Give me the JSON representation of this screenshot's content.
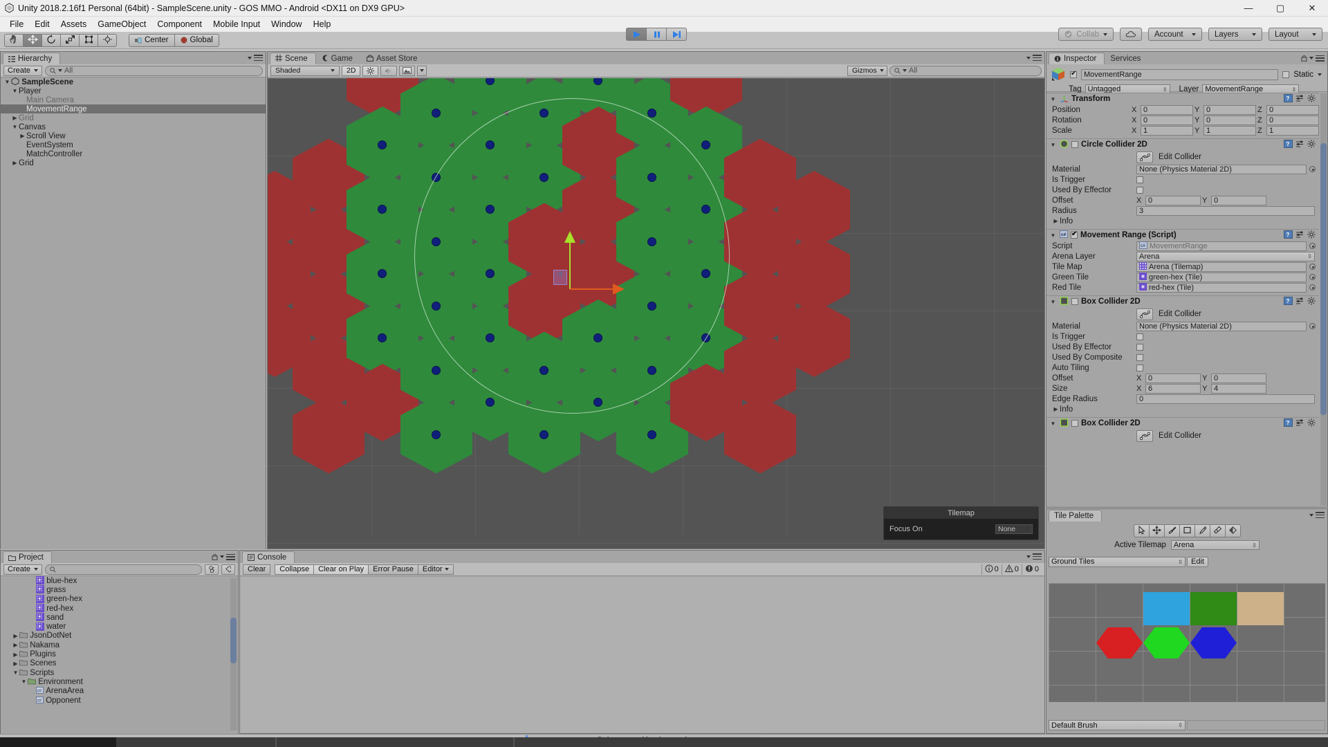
{
  "window": {
    "title": "Unity 2018.2.16f1 Personal (64bit) - SampleScene.unity - GOS MMO - Android <DX11 on DX9 GPU>",
    "minimize": "—",
    "maximize": "▢",
    "close": "✕",
    "app_icon": "unity-logo-icon"
  },
  "menubar": {
    "items": [
      "File",
      "Edit",
      "Assets",
      "GameObject",
      "Component",
      "Mobile Input",
      "Window",
      "Help"
    ]
  },
  "toolbar": {
    "tools": [
      {
        "name": "hand-tool",
        "glyph": "✋",
        "active": false
      },
      {
        "name": "move-tool",
        "glyph": "✥",
        "active": true
      },
      {
        "name": "rotate-tool",
        "glyph": "⟳",
        "active": false
      },
      {
        "name": "scale-tool",
        "glyph": "⤢",
        "active": false
      },
      {
        "name": "rect-tool",
        "glyph": "▣",
        "active": false
      },
      {
        "name": "transform-tool",
        "glyph": "✺",
        "active": false
      }
    ],
    "pivot_label": "Center",
    "space_label": "Global",
    "play_label": "▶",
    "pause_label": "❙❙",
    "step_label": "▶❙",
    "play_active": true,
    "collab_label": "Collab",
    "cloud_label": "cloud-icon",
    "account_label": "Account",
    "layers_label": "Layers",
    "layout_label": "Layout"
  },
  "hierarchy": {
    "tab": "Hierarchy",
    "create_label": "Create",
    "search_placeholder": "All",
    "items": [
      {
        "label": "SampleScene",
        "depth": 0,
        "arrow": "down",
        "icon": "scene-icon",
        "selected": false,
        "dim": false,
        "bold": true
      },
      {
        "label": "Player",
        "depth": 1,
        "arrow": "down",
        "icon": "",
        "selected": false,
        "dim": false
      },
      {
        "label": "Main Camera",
        "depth": 2,
        "arrow": "none",
        "icon": "",
        "selected": false,
        "dim": true
      },
      {
        "label": "MovementRange",
        "depth": 2,
        "arrow": "none",
        "icon": "",
        "selected": true,
        "dim": true
      },
      {
        "label": "Grid",
        "depth": 1,
        "arrow": "right",
        "icon": "",
        "selected": false,
        "dim": true
      },
      {
        "label": "Canvas",
        "depth": 1,
        "arrow": "down",
        "icon": "",
        "selected": false,
        "dim": false
      },
      {
        "label": "Scroll View",
        "depth": 2,
        "arrow": "right",
        "icon": "",
        "selected": false,
        "dim": false
      },
      {
        "label": "EventSystem",
        "depth": 2,
        "arrow": "none",
        "icon": "",
        "selected": false,
        "dim": false
      },
      {
        "label": "MatchController",
        "depth": 2,
        "arrow": "none",
        "icon": "",
        "selected": false,
        "dim": false
      },
      {
        "label": "Grid",
        "depth": 1,
        "arrow": "right",
        "icon": "",
        "selected": false,
        "dim": false
      }
    ]
  },
  "scene": {
    "tabs": [
      {
        "label": "Scene",
        "icon": "grid-icon",
        "active": true
      },
      {
        "label": "Game",
        "icon": "gamepad-icon",
        "active": false
      },
      {
        "label": "Asset Store",
        "icon": "store-icon",
        "active": false
      }
    ],
    "shading_label": "Shaded",
    "mode_2d_label": "2D",
    "light_icon": "sun-icon",
    "audio_icon": "speaker-icon",
    "fx_icon": "image-icon",
    "gizmos_label": "Gizmos",
    "search_placeholder": "All",
    "overlay": {
      "title": "Tilemap",
      "focus_label": "Focus On",
      "focus_value": "None"
    }
  },
  "inspector": {
    "tabs": [
      {
        "label": "Inspector",
        "active": true
      },
      {
        "label": "Services",
        "active": false
      }
    ],
    "object_name": "MovementRange",
    "object_enabled": true,
    "static_label": "Static",
    "static_checked": false,
    "tag_label": "Tag",
    "tag_value": "Untagged",
    "layer_label": "Layer",
    "layer_value": "MovementRange",
    "components": [
      {
        "name": "Transform",
        "icon": "transform-icon",
        "has_checkbox": false,
        "rows": [
          {
            "type": "vec3",
            "label": "Position",
            "x": "0",
            "y": "0",
            "z": "0"
          },
          {
            "type": "vec3",
            "label": "Rotation",
            "x": "0",
            "y": "0",
            "z": "0"
          },
          {
            "type": "vec3",
            "label": "Scale",
            "x": "1",
            "y": "1",
            "z": "1"
          }
        ]
      },
      {
        "name": "Circle Collider 2D",
        "icon": "circle-collider-icon",
        "has_checkbox": true,
        "checked": false,
        "rows": [
          {
            "type": "editcollider",
            "label": "Edit Collider"
          },
          {
            "type": "object",
            "label": "Material",
            "value": "None (Physics Material 2D)"
          },
          {
            "type": "check",
            "label": "Is Trigger",
            "checked": false
          },
          {
            "type": "check",
            "label": "Used By Effector",
            "checked": false
          },
          {
            "type": "vec2",
            "label": "Offset",
            "x": "0",
            "y": "0"
          },
          {
            "type": "text",
            "label": "Radius",
            "value": "3"
          },
          {
            "type": "foldout",
            "label": "Info"
          }
        ]
      },
      {
        "name": "Movement Range (Script)",
        "icon": "cs-script-icon",
        "has_checkbox": true,
        "checked": true,
        "rows": [
          {
            "type": "object",
            "label": "Script",
            "value": "MovementRange",
            "dim": true,
            "icon": "cs-script-icon"
          },
          {
            "type": "dropdown",
            "label": "Arena Layer",
            "value": "Arena"
          },
          {
            "type": "object",
            "label": "Tile Map",
            "value": "Arena (Tilemap)",
            "icon": "tilemap-icon"
          },
          {
            "type": "object",
            "label": "Green Tile",
            "value": "green-hex (Tile)",
            "icon": "tile-icon"
          },
          {
            "type": "object",
            "label": "Red Tile",
            "value": "red-hex (Tile)",
            "icon": "tile-icon"
          }
        ]
      },
      {
        "name": "Box Collider 2D",
        "icon": "box-collider-icon",
        "has_checkbox": true,
        "checked": false,
        "rows": [
          {
            "type": "editcollider",
            "label": "Edit Collider"
          },
          {
            "type": "object",
            "label": "Material",
            "value": "None (Physics Material 2D)"
          },
          {
            "type": "check",
            "label": "Is Trigger",
            "checked": false
          },
          {
            "type": "check",
            "label": "Used By Effector",
            "checked": false
          },
          {
            "type": "check",
            "label": "Used By Composite",
            "checked": false
          },
          {
            "type": "check",
            "label": "Auto Tiling",
            "checked": false
          },
          {
            "type": "vec2",
            "label": "Offset",
            "x": "0",
            "y": "0"
          },
          {
            "type": "vec2",
            "label": "Size",
            "x": "6",
            "y": "4"
          },
          {
            "type": "text",
            "label": "Edge Radius",
            "value": "0"
          },
          {
            "type": "foldout",
            "label": "Info"
          }
        ]
      },
      {
        "name": "Box Collider 2D",
        "icon": "box-collider-icon",
        "has_checkbox": true,
        "checked": false,
        "rows": [
          {
            "type": "editcollider",
            "label": "Edit Collider"
          }
        ]
      }
    ]
  },
  "project": {
    "tab": "Project",
    "create_label": "Create",
    "search_placeholder": "",
    "items": [
      {
        "label": "blue-hex",
        "depth": 3,
        "arrow": "none",
        "icon": "tile-asset-icon"
      },
      {
        "label": "grass",
        "depth": 3,
        "arrow": "none",
        "icon": "tile-asset-icon"
      },
      {
        "label": "green-hex",
        "depth": 3,
        "arrow": "none",
        "icon": "tile-asset-icon"
      },
      {
        "label": "red-hex",
        "depth": 3,
        "arrow": "none",
        "icon": "tile-asset-icon"
      },
      {
        "label": "sand",
        "depth": 3,
        "arrow": "none",
        "icon": "tile-asset-icon"
      },
      {
        "label": "water",
        "depth": 3,
        "arrow": "none",
        "icon": "tile-asset-icon"
      },
      {
        "label": "JsonDotNet",
        "depth": 1,
        "arrow": "right",
        "icon": "folder-icon"
      },
      {
        "label": "Nakama",
        "depth": 1,
        "arrow": "right",
        "icon": "folder-icon"
      },
      {
        "label": "Plugins",
        "depth": 1,
        "arrow": "right",
        "icon": "folder-icon"
      },
      {
        "label": "Scenes",
        "depth": 1,
        "arrow": "right",
        "icon": "folder-icon"
      },
      {
        "label": "Scripts",
        "depth": 1,
        "arrow": "down",
        "icon": "folder-icon"
      },
      {
        "label": "Environment",
        "depth": 2,
        "arrow": "down",
        "icon": "folder-open-icon"
      },
      {
        "label": "ArenaArea",
        "depth": 3,
        "arrow": "none",
        "icon": "cs-script-icon"
      },
      {
        "label": "Opponent",
        "depth": 3,
        "arrow": "none",
        "icon": "cs-script-icon"
      }
    ]
  },
  "console": {
    "tab": "Console",
    "buttons": [
      {
        "label": "Clear",
        "active": false,
        "dropdown": false
      },
      {
        "label": "Collapse",
        "active": true,
        "dropdown": false
      },
      {
        "label": "Clear on Play",
        "active": true,
        "dropdown": false
      },
      {
        "label": "Error Pause",
        "active": false,
        "dropdown": false
      },
      {
        "label": "Editor",
        "active": false,
        "dropdown": true
      }
    ],
    "counts": [
      {
        "icon": "info-icon",
        "value": "0"
      },
      {
        "icon": "warning-icon",
        "value": "0"
      },
      {
        "icon": "error-icon",
        "value": "0"
      }
    ]
  },
  "tile_palette": {
    "tab": "Tile Palette",
    "tools": [
      {
        "name": "select-tool",
        "glyph": "➤"
      },
      {
        "name": "move-tool",
        "glyph": "✥"
      },
      {
        "name": "brush-tool",
        "glyph": "🖌"
      },
      {
        "name": "box-fill-tool",
        "glyph": "▢"
      },
      {
        "name": "picker-tool",
        "glyph": "⟋"
      },
      {
        "name": "eraser-tool",
        "glyph": "◈"
      },
      {
        "name": "fill-tool",
        "glyph": "◆"
      }
    ],
    "active_tilemap_label": "Active Tilemap",
    "active_tilemap_value": "Arena",
    "palette_value": "Ground Tiles",
    "edit_label": "Edit",
    "brush_value": "Default Brush",
    "tiles": [
      {
        "name": "water",
        "kind": "square",
        "color": "#2fa3dd",
        "row": 0,
        "col": 2
      },
      {
        "name": "grass",
        "kind": "square",
        "color": "#2f8a16",
        "row": 0,
        "col": 3
      },
      {
        "name": "sand",
        "kind": "square",
        "color": "#cdb188",
        "row": 0,
        "col": 4
      },
      {
        "name": "red-hex",
        "kind": "hex",
        "color": "#d81f22",
        "row": 1,
        "col": 1
      },
      {
        "name": "green-hex",
        "kind": "hex",
        "color": "#1fd81f",
        "row": 1,
        "col": 2
      },
      {
        "name": "blue-hex",
        "kind": "hex",
        "color": "#1f1fd8",
        "row": 1,
        "col": 3
      }
    ]
  },
  "status": {
    "message": "Bake paused in play mode"
  },
  "colors": {
    "green_hex": "#2f8a3c",
    "red_hex": "#9e3232",
    "grid_bg": "#545454",
    "dot": "#10207a",
    "gizmo_green": "#a8e02a",
    "gizmo_red": "#e05a20",
    "range_circle": "#cfe8cf"
  },
  "scene_grid": {
    "note": "Hex arena grid, 11 columns of pointy-top hexes, green = in range, red = out of range",
    "columns": [
      {
        "col": 0,
        "hexes": [
          {
            "row": 2,
            "c": "red"
          },
          {
            "row": 3,
            "c": "red"
          },
          {
            "row": 4,
            "c": "red"
          }
        ]
      },
      {
        "col": 1,
        "hexes": [
          {
            "row": 1,
            "c": "red"
          },
          {
            "row": 2,
            "c": "red"
          },
          {
            "row": 3,
            "c": "red"
          },
          {
            "row": 4,
            "c": "red"
          },
          {
            "row": 5,
            "c": "red"
          }
        ]
      },
      {
        "col": 2,
        "hexes": [
          {
            "row": 0,
            "c": "red"
          },
          {
            "row": 1,
            "c": "green"
          },
          {
            "row": 2,
            "c": "green"
          },
          {
            "row": 3,
            "c": "green"
          },
          {
            "row": 4,
            "c": "green"
          },
          {
            "row": 5,
            "c": "red"
          }
        ]
      },
      {
        "col": 3,
        "hexes": [
          {
            "row": 0,
            "c": "green"
          },
          {
            "row": 1,
            "c": "green"
          },
          {
            "row": 2,
            "c": "green"
          },
          {
            "row": 3,
            "c": "green"
          },
          {
            "row": 4,
            "c": "green"
          },
          {
            "row": 5,
            "c": "green"
          }
        ]
      },
      {
        "col": 4,
        "hexes": [
          {
            "row": 0,
            "c": "green"
          },
          {
            "row": 1,
            "c": "green"
          },
          {
            "row": 2,
            "c": "green"
          },
          {
            "row": 3,
            "c": "green"
          },
          {
            "row": 4,
            "c": "green"
          },
          {
            "row": 5,
            "c": "green"
          }
        ]
      },
      {
        "col": 5,
        "hexes": [
          {
            "row": 0,
            "c": "green"
          },
          {
            "row": 1,
            "c": "green"
          },
          {
            "row": 2,
            "c": "red"
          },
          {
            "row": 3,
            "c": "red"
          },
          {
            "row": 4,
            "c": "green"
          },
          {
            "row": 5,
            "c": "green"
          }
        ]
      },
      {
        "col": 6,
        "hexes": [
          {
            "row": 0,
            "c": "green"
          },
          {
            "row": 1,
            "c": "red"
          },
          {
            "row": 2,
            "c": "red"
          },
          {
            "row": 3,
            "c": "red"
          },
          {
            "row": 4,
            "c": "green"
          },
          {
            "row": 5,
            "c": "green"
          }
        ]
      },
      {
        "col": 7,
        "hexes": [
          {
            "row": 0,
            "c": "green"
          },
          {
            "row": 1,
            "c": "green"
          },
          {
            "row": 2,
            "c": "green"
          },
          {
            "row": 3,
            "c": "green"
          },
          {
            "row": 4,
            "c": "green"
          },
          {
            "row": 5,
            "c": "green"
          }
        ]
      },
      {
        "col": 8,
        "hexes": [
          {
            "row": 0,
            "c": "red"
          },
          {
            "row": 1,
            "c": "green"
          },
          {
            "row": 2,
            "c": "green"
          },
          {
            "row": 3,
            "c": "green"
          },
          {
            "row": 4,
            "c": "green"
          },
          {
            "row": 5,
            "c": "red"
          }
        ]
      },
      {
        "col": 9,
        "hexes": [
          {
            "row": 1,
            "c": "red"
          },
          {
            "row": 2,
            "c": "red"
          },
          {
            "row": 3,
            "c": "red"
          },
          {
            "row": 4,
            "c": "red"
          },
          {
            "row": 5,
            "c": "red"
          }
        ]
      },
      {
        "col": 10,
        "hexes": [
          {
            "row": 2,
            "c": "red"
          },
          {
            "row": 3,
            "c": "red"
          },
          {
            "row": 4,
            "c": "red"
          }
        ]
      }
    ]
  }
}
